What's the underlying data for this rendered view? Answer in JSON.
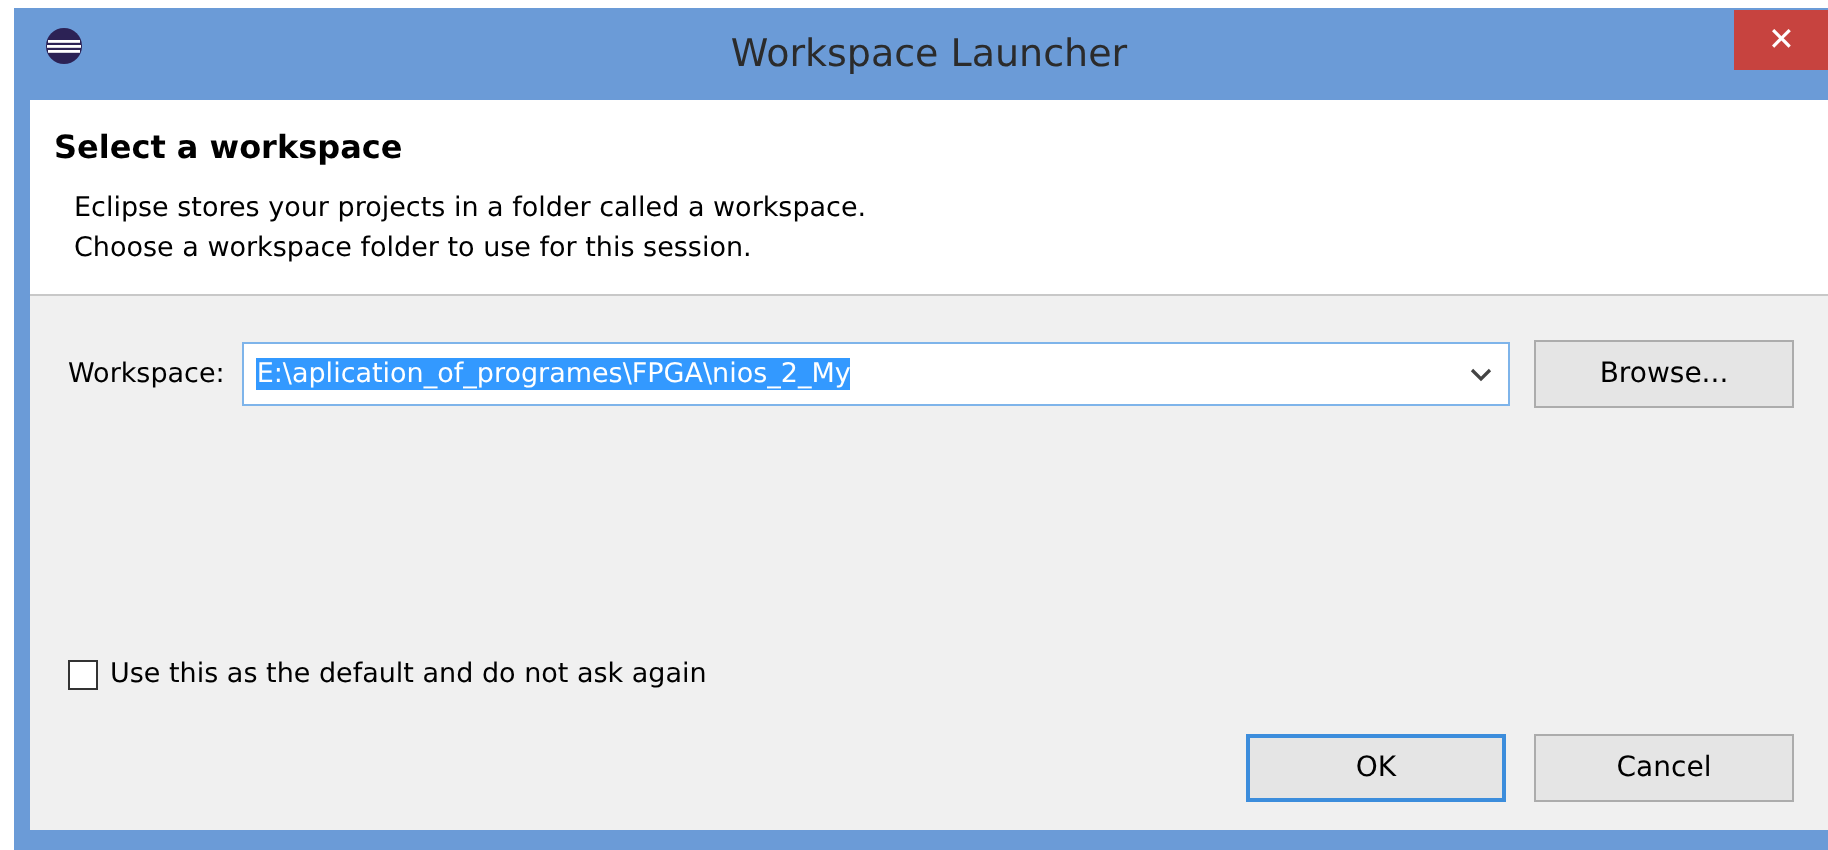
{
  "window": {
    "title": "Workspace Launcher",
    "close": "✕"
  },
  "header": {
    "title": "Select a workspace",
    "lines": [
      "Eclipse stores your projects in a folder called a workspace.",
      "Choose a workspace folder to use for this session."
    ]
  },
  "workspace": {
    "label": "Workspace:",
    "value": "E:\\aplication_of_programes\\FPGA\\nios_2_My",
    "text_selected": true,
    "browse": "Browse..."
  },
  "default_option": {
    "label": "Use this as the default and do not ask again",
    "checked": false
  },
  "buttons": [
    {
      "label": "OK",
      "default": true
    },
    {
      "label": "Cancel",
      "default": false
    }
  ]
}
